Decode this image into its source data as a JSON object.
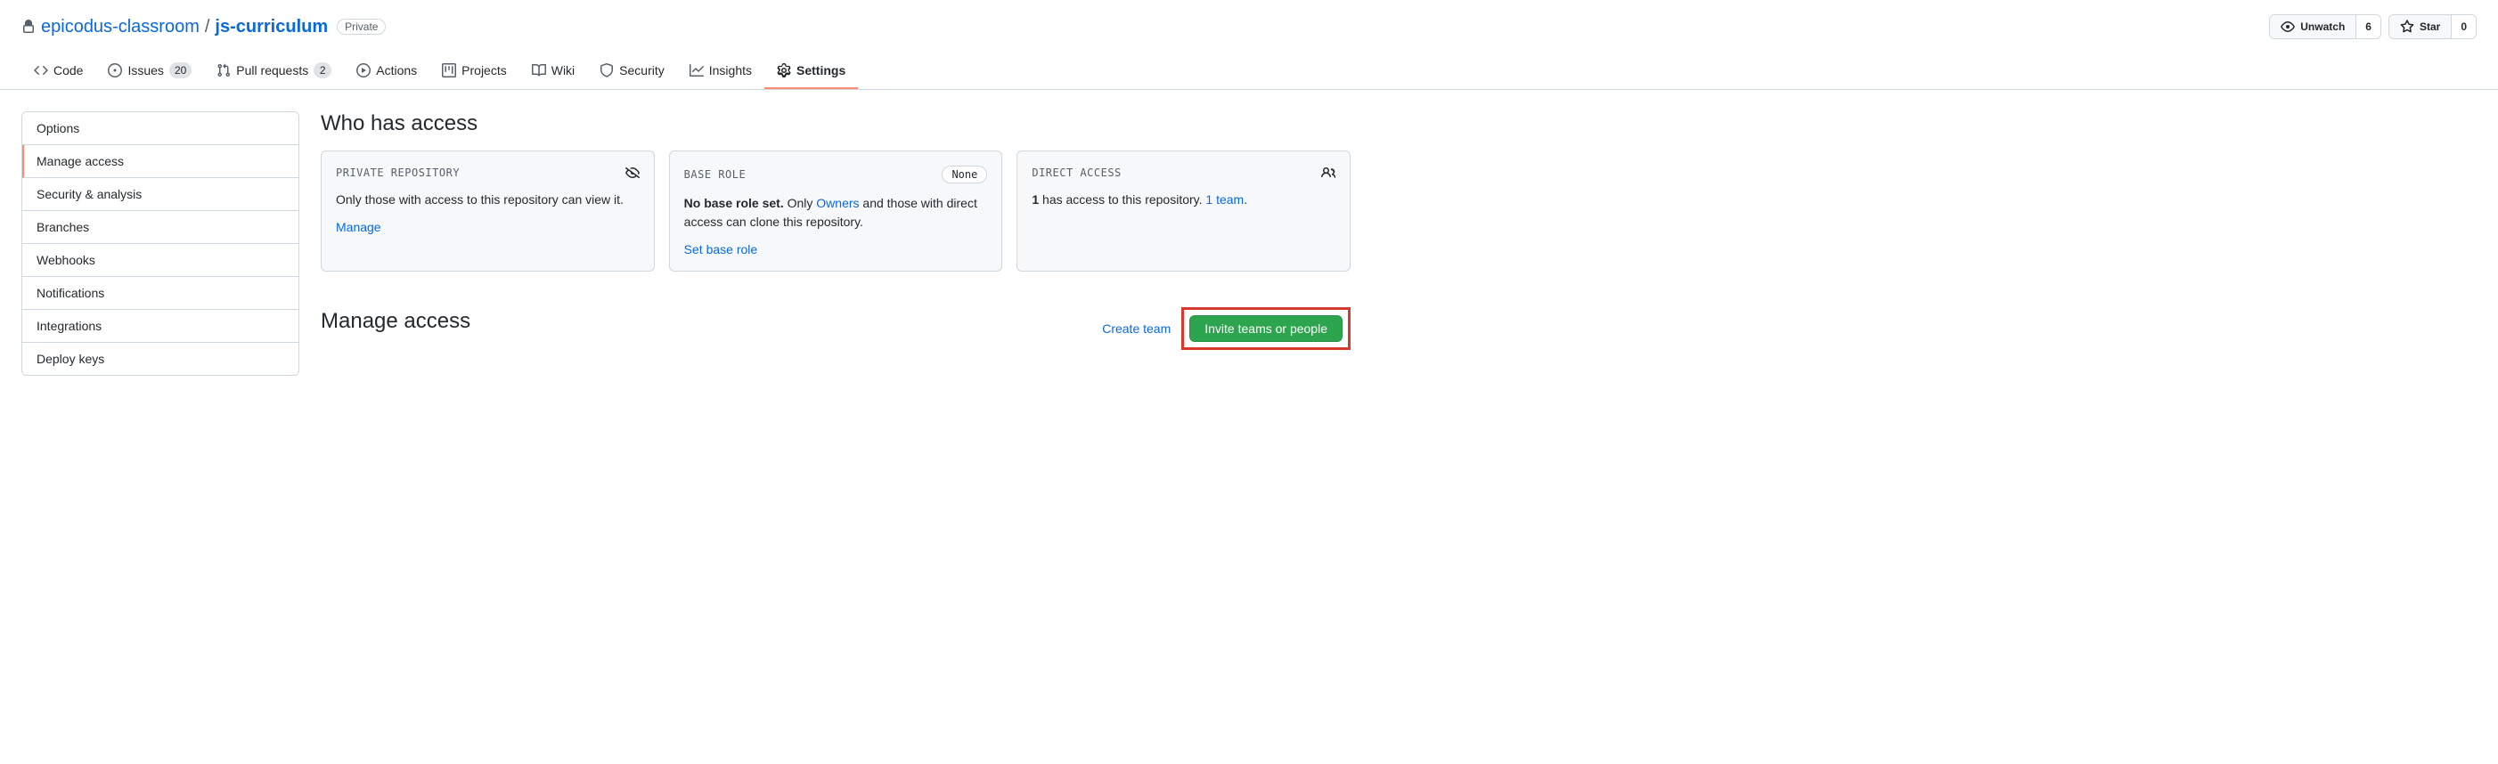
{
  "breadcrumb": {
    "owner": "epicodus-classroom",
    "repo": "js-curriculum",
    "visibility": "Private"
  },
  "header_buttons": {
    "unwatch": {
      "label": "Unwatch",
      "count": "6"
    },
    "star": {
      "label": "Star",
      "count": "0"
    }
  },
  "tabs": {
    "code": "Code",
    "issues": {
      "label": "Issues",
      "count": "20"
    },
    "pulls": {
      "label": "Pull requests",
      "count": "2"
    },
    "actions": "Actions",
    "projects": "Projects",
    "wiki": "Wiki",
    "security": "Security",
    "insights": "Insights",
    "settings": "Settings"
  },
  "sidebar": {
    "items": [
      "Options",
      "Manage access",
      "Security & analysis",
      "Branches",
      "Webhooks",
      "Notifications",
      "Integrations",
      "Deploy keys"
    ]
  },
  "main": {
    "heading1": "Who has access",
    "card_private": {
      "title": "PRIVATE REPOSITORY",
      "body": "Only those with access to this repository can view it.",
      "link": "Manage"
    },
    "card_base": {
      "title": "BASE ROLE",
      "badge": "None",
      "bold": "No base role set.",
      "body1": " Only ",
      "owners": "Owners",
      "body2": " and those with direct access can clone this repository.",
      "link": "Set base role"
    },
    "card_direct": {
      "title": "DIRECT ACCESS",
      "bold": "1",
      "body": " has access to this repository. ",
      "team_link": "1 team"
    },
    "heading2": "Manage access",
    "create_team": "Create team",
    "invite_btn": "Invite teams or people"
  }
}
